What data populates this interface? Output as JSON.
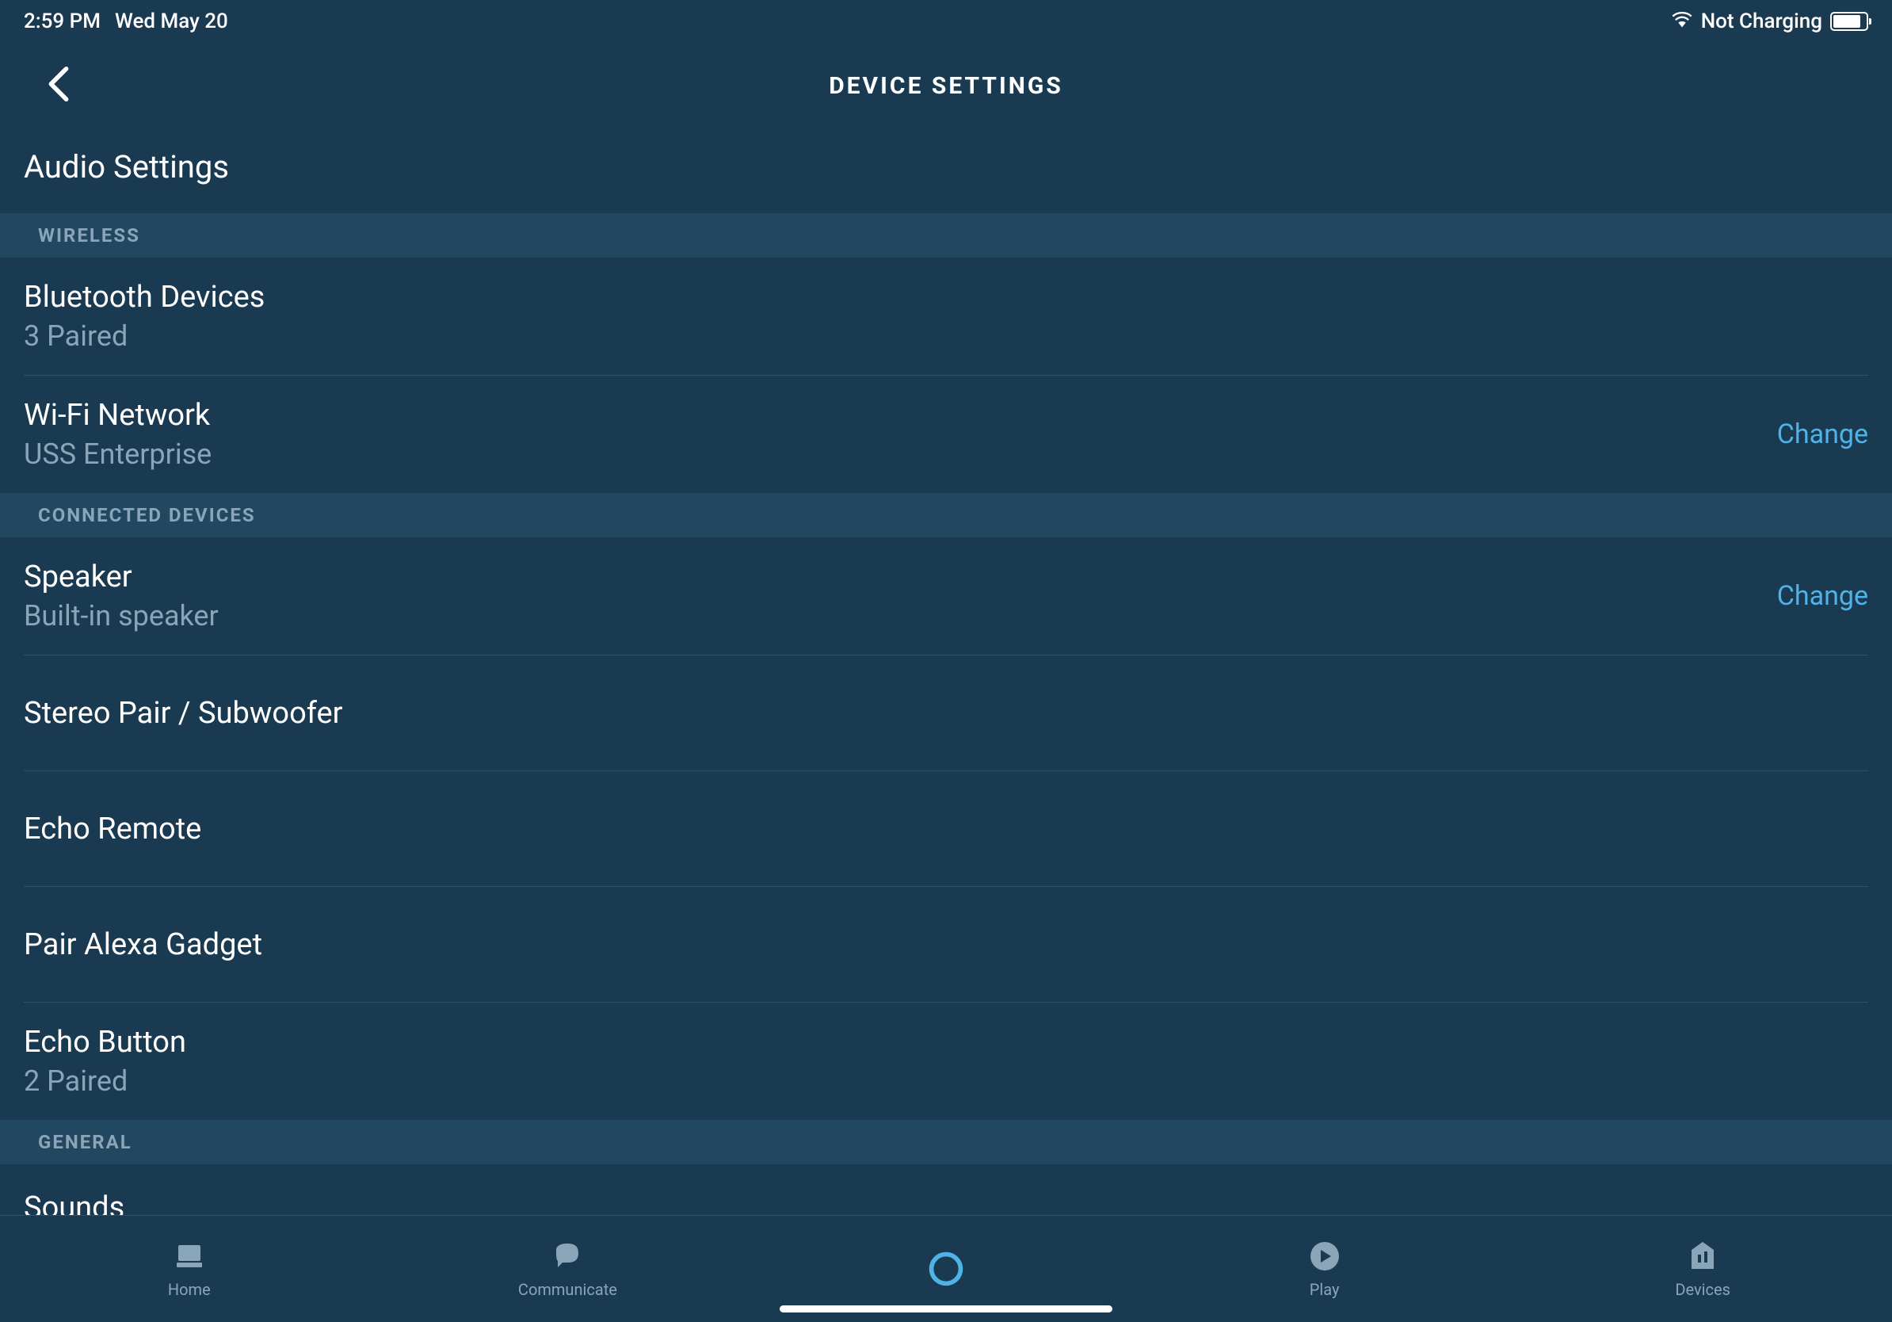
{
  "status_bar": {
    "time": "2:59 PM",
    "date": "Wed May 20",
    "charging_status": "Not Charging"
  },
  "header": {
    "title": "DEVICE SETTINGS",
    "subtitle": "Audio Settings"
  },
  "sections": {
    "wireless": {
      "header": "WIRELESS",
      "bluetooth": {
        "title": "Bluetooth Devices",
        "subtitle": "3 Paired"
      },
      "wifi": {
        "title": "Wi-Fi Network",
        "subtitle": "USS Enterprise",
        "action": "Change"
      }
    },
    "connected_devices": {
      "header": "CONNECTED DEVICES",
      "speaker": {
        "title": "Speaker",
        "subtitle": "Built-in speaker",
        "action": "Change"
      },
      "stereo_pair": {
        "title": "Stereo Pair / Subwoofer"
      },
      "echo_remote": {
        "title": "Echo Remote"
      },
      "pair_gadget": {
        "title": "Pair Alexa Gadget"
      },
      "echo_button": {
        "title": "Echo Button",
        "subtitle": "2 Paired"
      }
    },
    "general": {
      "header": "GENERAL",
      "sounds": {
        "title": "Sounds"
      }
    }
  },
  "tabs": {
    "home": "Home",
    "communicate": "Communicate",
    "play": "Play",
    "devices": "Devices"
  }
}
